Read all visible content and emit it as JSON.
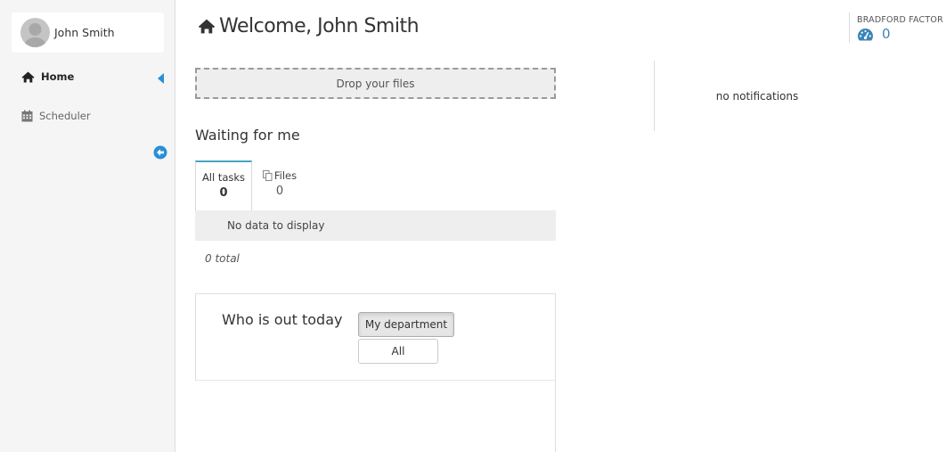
{
  "user": {
    "name": "John Smith"
  },
  "sidebar": {
    "items": [
      {
        "label": "Home",
        "icon": "home-icon",
        "active": true
      },
      {
        "label": "Scheduler",
        "icon": "calendar-icon",
        "active": false
      }
    ]
  },
  "header": {
    "title": "Welcome, John Smith",
    "icon": "home-icon"
  },
  "dropzone": {
    "label": "Drop your files"
  },
  "waiting": {
    "title": "Waiting for me",
    "tabs": [
      {
        "label": "All tasks",
        "count": "0",
        "active": true
      },
      {
        "label": "Files",
        "count": "0",
        "icon": "copy-icon",
        "active": false
      }
    ],
    "empty_text": "No data to display",
    "total": "0 total"
  },
  "out_today": {
    "title": "Who is out today",
    "buttons": [
      {
        "label": "My department",
        "active": true
      },
      {
        "label": "All",
        "active": false
      }
    ]
  },
  "notifications": {
    "text": "no notifications"
  },
  "bradford": {
    "label": "BRADFORD FACTOR",
    "value": "0",
    "icon": "dashboard-icon"
  },
  "colors": {
    "accent": "#3a85b8",
    "tab_accent": "#4aa3c4",
    "sidebar_bg": "#f5f5f5"
  }
}
